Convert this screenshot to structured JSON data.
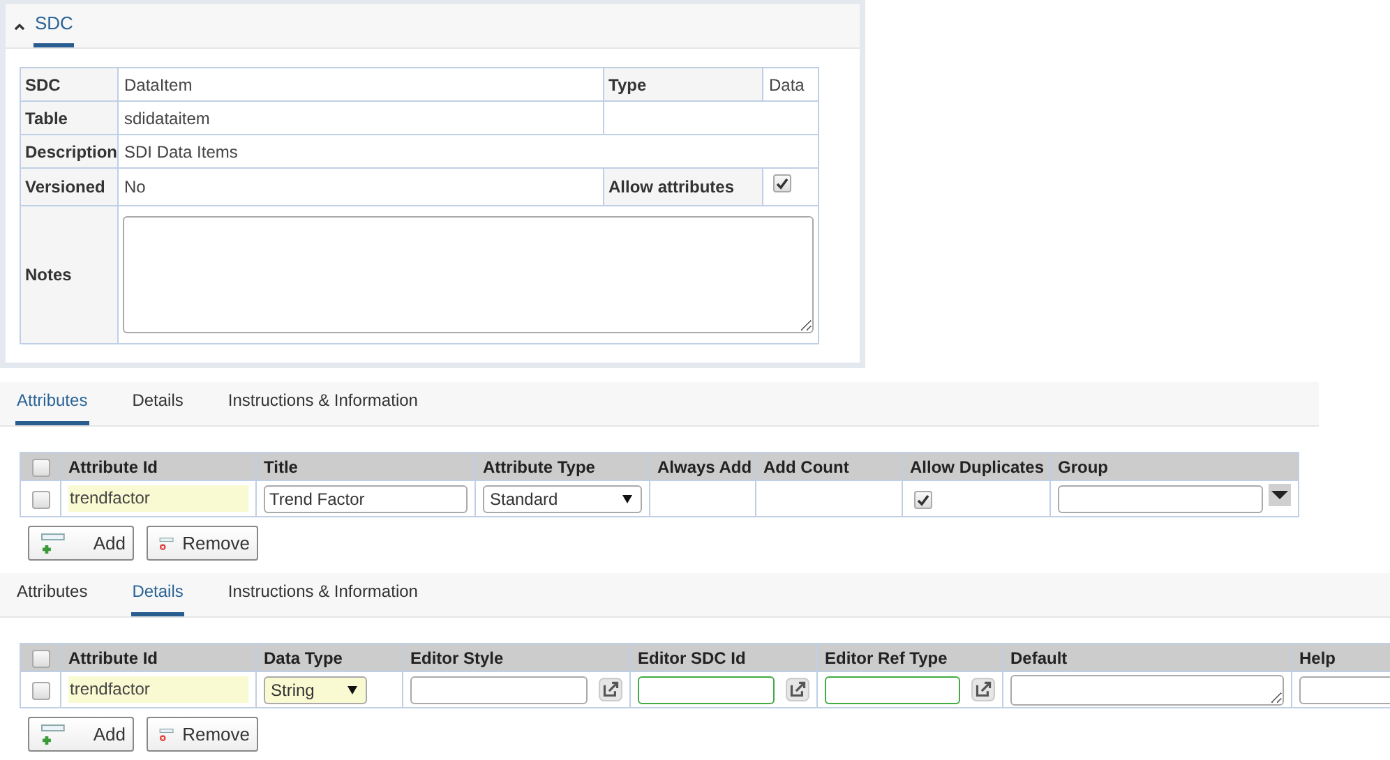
{
  "sdc_panel": {
    "title": "SDC",
    "expanded": true,
    "rows": [
      {
        "kind": "pair",
        "label": "SDC",
        "value": "DataItem",
        "label2": "Type",
        "value2": "Data"
      },
      {
        "kind": "half",
        "label": "Table",
        "value": "sdidataitem"
      },
      {
        "kind": "full",
        "label": "Description",
        "value": "SDI Data Items"
      },
      {
        "kind": "pair-check",
        "label": "Versioned",
        "value": "No",
        "label2": "Allow attributes",
        "checked": true
      },
      {
        "kind": "textarea",
        "label": "Notes"
      }
    ]
  },
  "sections": [
    {
      "tabs": [
        {
          "label": "Attributes",
          "selected": true
        },
        {
          "label": "Details",
          "selected": false
        },
        {
          "label": "Instructions & Information",
          "selected": false
        }
      ],
      "grid": {
        "all_selected": false,
        "columns": [
          "Attribute Id",
          "Title",
          "Attribute Type",
          "Always Add",
          "Add Count",
          "Allow Duplicates",
          "Group"
        ],
        "rows": [
          {
            "selected": false,
            "cells": [
              {
                "kind": "id",
                "text": "trendfactor"
              },
              {
                "kind": "input",
                "value": "Trend Factor"
              },
              {
                "kind": "select",
                "value": "Standard",
                "highlighted": false
              },
              {
                "kind": "empty"
              },
              {
                "kind": "empty"
              },
              {
                "kind": "check",
                "checked": true
              },
              {
                "kind": "combo"
              }
            ]
          }
        ]
      },
      "buttons": [
        {
          "kind": "add",
          "label": "Add"
        },
        {
          "kind": "remove",
          "label": "Remove"
        }
      ]
    },
    {
      "tabs": [
        {
          "label": "Attributes",
          "selected": false
        },
        {
          "label": "Details",
          "selected": true
        },
        {
          "label": "Instructions & Information",
          "selected": false
        }
      ],
      "grid": {
        "all_selected": false,
        "columns": [
          "Attribute Id",
          "Data Type",
          "Editor Style",
          "Editor SDC Id",
          "Editor Ref Type",
          "Default",
          "Help"
        ],
        "rows": [
          {
            "selected": false,
            "cells": [
              {
                "kind": "id",
                "text": "trendfactor"
              },
              {
                "kind": "select",
                "value": "String",
                "highlighted": true
              },
              {
                "kind": "lookup",
                "required": false
              },
              {
                "kind": "lookup",
                "required": true
              },
              {
                "kind": "lookup",
                "required": true
              },
              {
                "kind": "textarea"
              },
              {
                "kind": "input"
              }
            ]
          }
        ]
      },
      "buttons": [
        {
          "kind": "add",
          "label": "Add"
        },
        {
          "kind": "remove",
          "label": "Remove"
        }
      ]
    }
  ]
}
